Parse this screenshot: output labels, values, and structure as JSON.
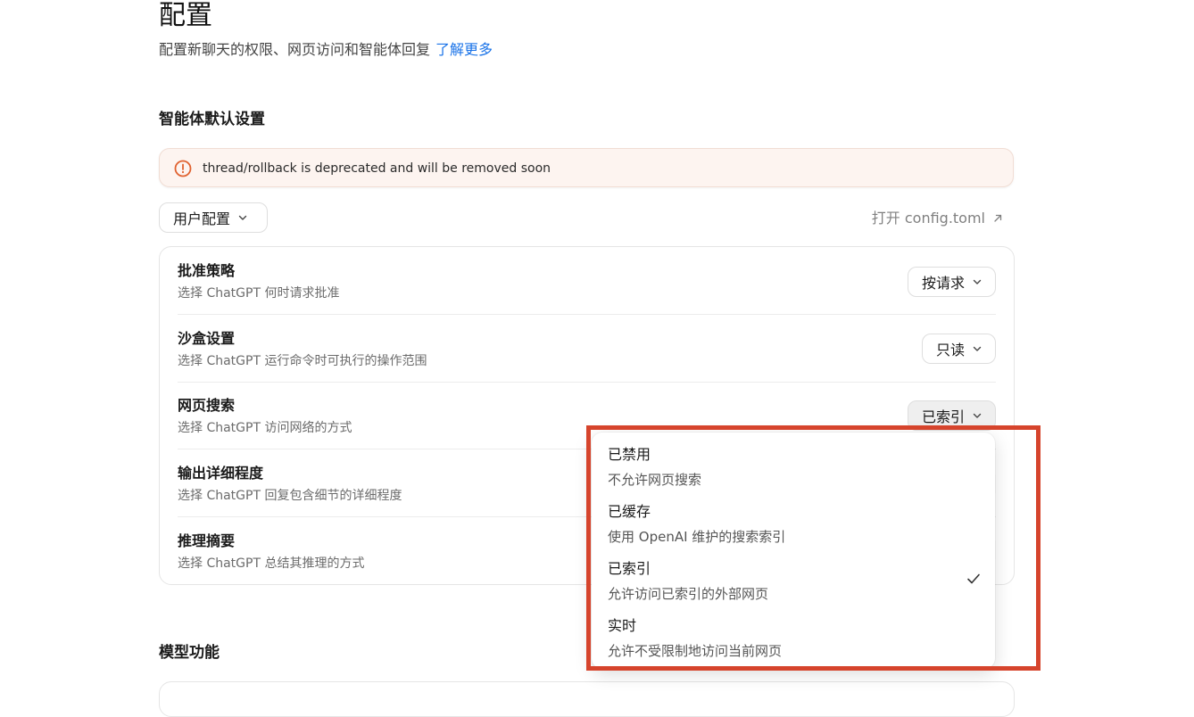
{
  "header": {
    "title": "配置",
    "subtitle": "配置新聊天的权限、网页访问和智能体回复",
    "learn_more": "了解更多"
  },
  "sections": {
    "agent_defaults": "智能体默认设置",
    "model_features": "模型功能"
  },
  "warning": {
    "text": "thread/rollback is deprecated and will be removed soon",
    "color": "#e0612f"
  },
  "scope": {
    "label": "用户配置"
  },
  "open_config": {
    "label": "打开 config.toml"
  },
  "settings": [
    {
      "label": "批准策略",
      "description": "选择 ChatGPT 何时请求批准",
      "value": "按请求"
    },
    {
      "label": "沙盒设置",
      "description": "选择 ChatGPT 运行命令时可执行的操作范围",
      "value": "只读"
    },
    {
      "label": "网页搜索",
      "description": "选择 ChatGPT 访问网络的方式",
      "value": "已索引"
    },
    {
      "label": "输出详细程度",
      "description": "选择 ChatGPT 回复包含细节的详细程度",
      "value": ""
    },
    {
      "label": "推理摘要",
      "description": "选择 ChatGPT 总结其推理的方式",
      "value": ""
    }
  ],
  "web_search_menu": {
    "options": [
      {
        "title": "已禁用",
        "description": "不允许网页搜索",
        "selected": false
      },
      {
        "title": "已缓存",
        "description": "使用 OpenAI 维护的搜索索引",
        "selected": false
      },
      {
        "title": "已索引",
        "description": "允许访问已索引的外部网页",
        "selected": true
      },
      {
        "title": "实时",
        "description": "允许不受限制地访问当前网页",
        "selected": false
      }
    ]
  },
  "colors": {
    "link": "#1a73e8",
    "highlight": "#d6442c"
  }
}
